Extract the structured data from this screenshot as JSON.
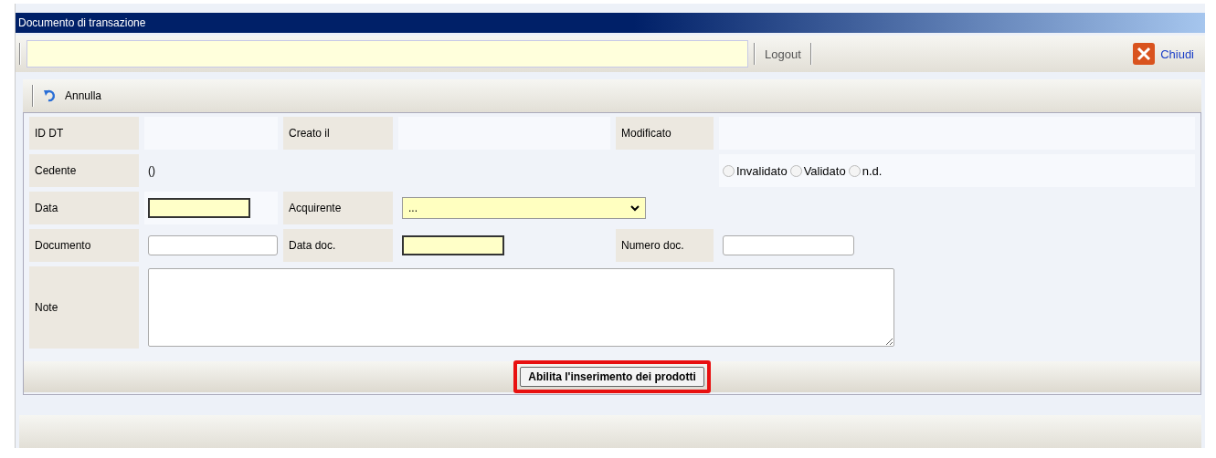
{
  "window": {
    "title": "Documento di transazione"
  },
  "toolbar": {
    "logout": "Logout",
    "close": "Chiudi"
  },
  "subtoolbar": {
    "undo": "Annulla"
  },
  "form": {
    "id_label": "ID DT",
    "created_label": "Creato il",
    "modified_label": "Modificato",
    "seller_label": "Cedente",
    "seller_value": "()",
    "validation": [
      {
        "label": "Invalidato",
        "selected": false
      },
      {
        "label": "Validato",
        "selected": false
      },
      {
        "label": "n.d.",
        "selected": false
      }
    ],
    "date": {
      "label": "Data",
      "required": true
    },
    "buyer": {
      "label": "Acquirente",
      "value": "...",
      "required": true
    },
    "document": {
      "label": "Documento",
      "required": false
    },
    "doc_date": {
      "label": "Data doc.",
      "required": true
    },
    "doc_number": {
      "label": "Numero doc.",
      "required": false
    },
    "note_label": "Note",
    "enable_button": {
      "label": "Abilita l'inserimento dei prodotti",
      "highlighted": true
    }
  }
}
